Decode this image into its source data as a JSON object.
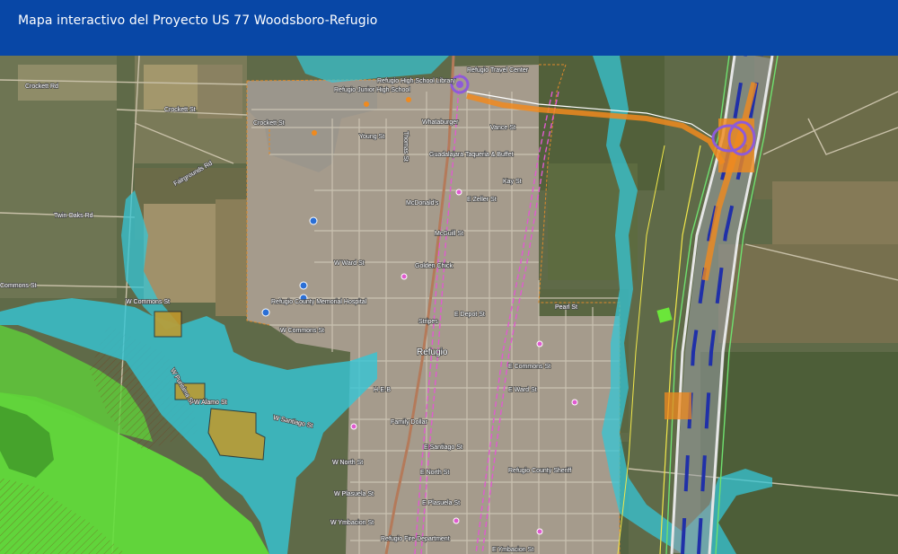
{
  "header": {
    "title": "Mapa interactivo del Proyecto US 77 Woodsboro-Refugio"
  },
  "map": {
    "colors": {
      "flood_zone": "#35c6d6",
      "wildlife_area": "#62e03a",
      "project_corridor": "#f08a1e",
      "interchange": "#8e5bd8",
      "railroad": "#e05ad0",
      "highway_lanes": "#2030a8",
      "parcels": "#c49a2a"
    },
    "labels": {
      "crockett_rd": "Crockett Rd",
      "crockett_st": "Crockett St",
      "fairgrounds_rd": "Fairgrounds Rd",
      "twin_oaks_rd": "Twin Oaks Rd",
      "commons_st_west": "Commons St",
      "w_commons_st": "W Commons St",
      "w_commons_st_2": "W Commons St",
      "w_santiago_st": "W Santiago St",
      "w_north_st": "W North St",
      "w_plasuela_st": "W Plasuela St",
      "w_ymbacion_st": "W Ymbacion St",
      "w_alamo_st": "W Alamo St",
      "w_ward_st": "W Ward St",
      "w_purisima_st": "W Purisima St",
      "young_st": "Young St",
      "thomas_st": "Thomas St",
      "vance_st": "Vance St",
      "kay_st": "Kay St",
      "e_zeller_st": "E Zeller St",
      "mcguill_st": "McGuill St",
      "e_depot_st": "E Depot St",
      "pearl_st": "Pearl St",
      "e_commons_st": "E Commons St",
      "e_ward_st": "E Ward St",
      "e_santiago_st": "E Santiago St",
      "e_north_st": "E North St",
      "e_plasuela_st": "E Plasuela St",
      "e_ymbacion_st": "E Ymbacion St",
      "refugio": "Refugio",
      "refugio_junior_high": "Refugio Junior High School",
      "refugio_high_school": "Refugio High School Library",
      "refugio_travel_center": "Refugio Travel Center",
      "whataburger": "Whataburger",
      "guadalajara": "Guadalajara Taqueria & Buffet",
      "mcdonalds": "McDonald's",
      "golden_chick": "Golden Chick",
      "refugio_county_hospital": "Refugio County Memorial Hospital",
      "stripes": "Stripes",
      "h_e_b": "H-E-B",
      "family_dollar": "Family Dollar",
      "sheriff": "Refugio County Sheriff",
      "fire_department": "Refugio Fire Department"
    }
  }
}
